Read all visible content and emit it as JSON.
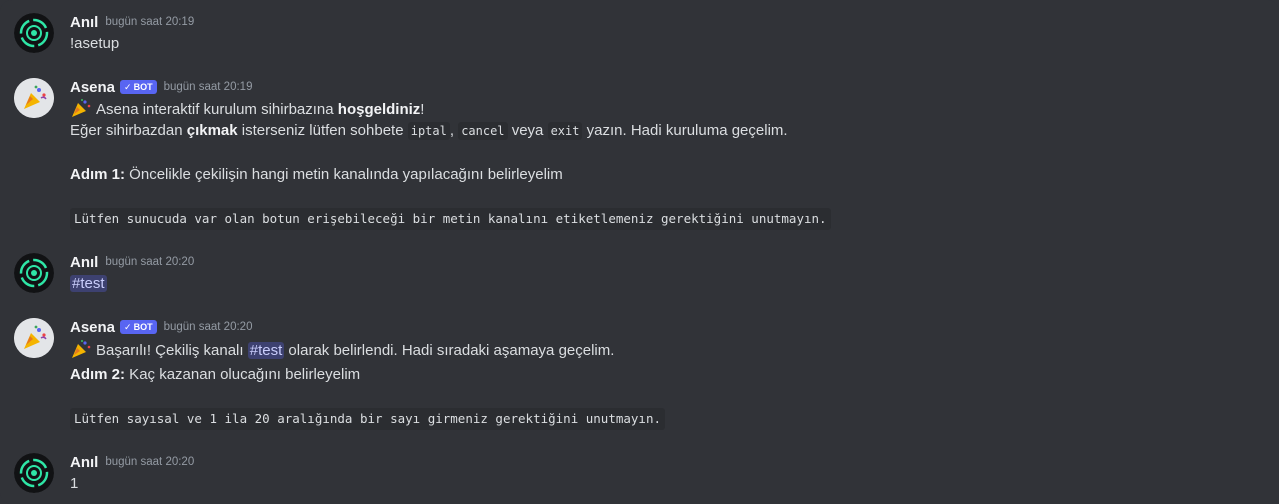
{
  "messages": [
    {
      "author": "Anıl",
      "timestamp": "bugün saat 20:19",
      "content": "!asetup"
    },
    {
      "author": "Asena",
      "bot_tag": "BOT",
      "timestamp": "bugün saat 20:19",
      "line1": {
        "pre": "Asena interaktif kurulum sihirbazına ",
        "bold": "hoşgeldiniz",
        "post": "!"
      },
      "line2": {
        "pre": "Eğer sihirbazdan ",
        "bold": "çıkmak",
        "mid": " isterseniz lütfen sohbete ",
        "code1": "iptal",
        "sep1": ", ",
        "code2": "cancel",
        "sep2": " veya ",
        "code3": "exit",
        "post": " yazın. Hadi kuruluma geçelim."
      },
      "step": {
        "label": "Adım 1:",
        "text": " Öncelikle çekilişin hangi metin kanalında yapılacağını belirleyelim"
      },
      "code_block": "Lütfen sunucuda var olan botun erişebileceği bir metin kanalını etiketlemeniz gerektiğini unutmayın."
    },
    {
      "author": "Anıl",
      "timestamp": "bugün saat 20:20",
      "content": "#test"
    },
    {
      "author": "Asena",
      "bot_tag": "BOT",
      "timestamp": "bugün saat 20:20",
      "line1": {
        "pre": "Başarılı! Çekiliş kanalı ",
        "mention": "#test",
        "post": " olarak belirlendi. Hadi sıradaki aşamaya geçelim."
      },
      "step": {
        "label": "Adım 2:",
        "text": " Kaç kazanan olucağını belirleyelim"
      },
      "code_block": "Lütfen sayısal ve 1 ila 20 aralığında bir sayı girmeniz gerektiğini unutmayın."
    },
    {
      "author": "Anıl",
      "timestamp": "bugün saat 20:20",
      "content": "1"
    }
  ],
  "icons": {
    "user_avatar": "green-ring-logo-icon",
    "bot_avatar": "party-popper-icon",
    "emoji": "party-popper-emoji-icon",
    "bot_check": "checkmark-icon"
  },
  "colors": {
    "background": "#313338",
    "username": "#f2f3f5",
    "timestamp": "#949ba4",
    "bot_tag": "#5865f2",
    "mention_bg": "rgba(88,101,242,0.3)",
    "code_bg": "#2b2d31",
    "avatar_accent": "#2ee6a6"
  }
}
